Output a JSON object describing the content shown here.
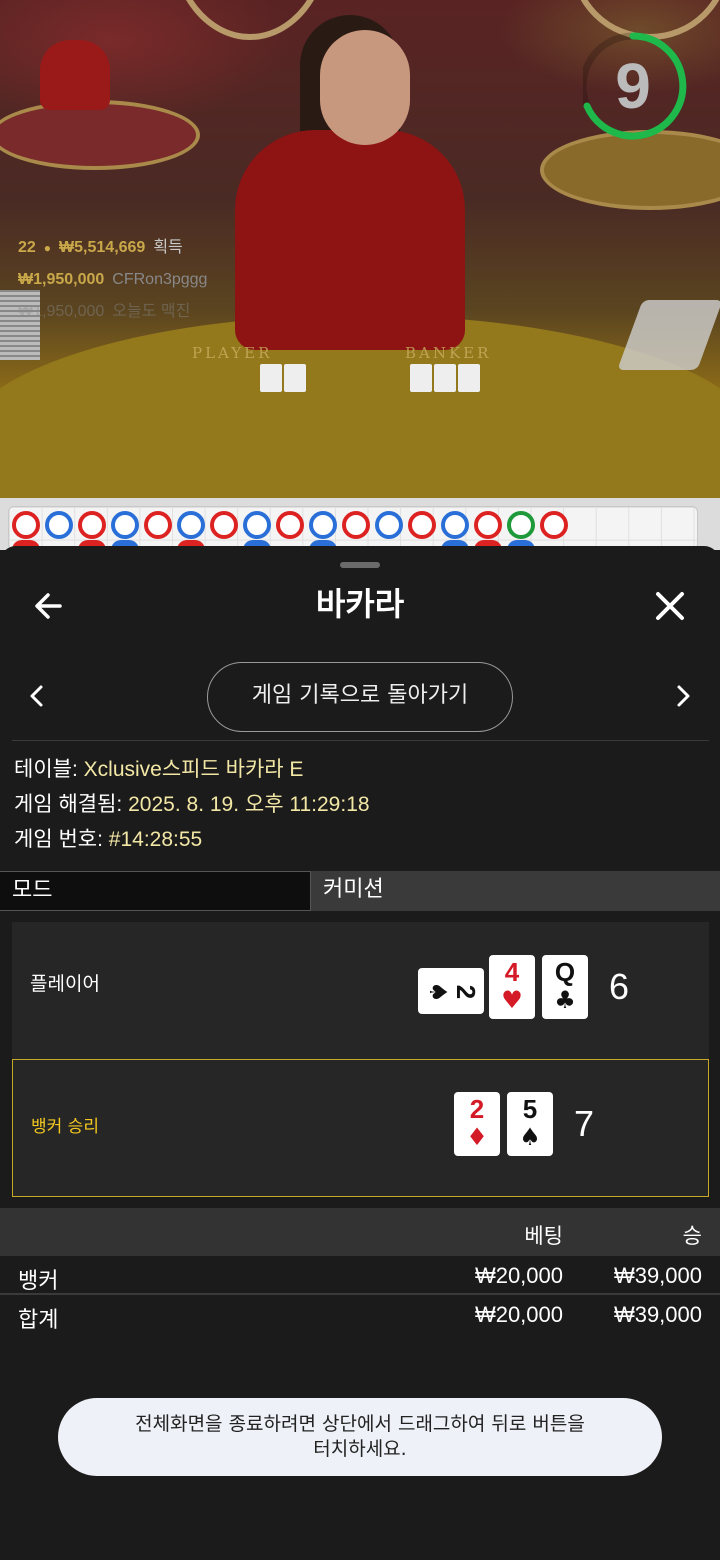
{
  "video": {
    "countdown": "9",
    "stats": {
      "players": "22",
      "winnings": "₩5,514,669",
      "winnings_label": "획득",
      "top_win_amount": "₩1,950,000",
      "top_win_user": "CFRon3pggg",
      "faded_amount": "₩1,950,000",
      "faded_text": "오늘도 맥진"
    },
    "felt_labels": {
      "player": "PLAYER",
      "banker": "BANKER"
    }
  },
  "header": {
    "title": "바카라",
    "back_icon": "arrow-left-icon",
    "close_icon": "close-icon"
  },
  "history": {
    "back_to_history_label": "게임 기록으로 돌아가기",
    "prev_icon": "chevron-left-icon",
    "next_icon": "chevron-right-icon"
  },
  "info": {
    "table_label": "테이블:",
    "table_value": "Xclusive스피드 바카라 E",
    "resolved_label": "게임 해결됨:",
    "resolved_value": "2025. 8. 19. 오후 11:29:18",
    "game_no_label": "게임 번호:",
    "game_no_value": "#14:28:55"
  },
  "tabs": {
    "mode": "모드",
    "commission": "커미션"
  },
  "result": {
    "player": {
      "label": "플레이어",
      "score": "6",
      "cards": [
        {
          "rank": "2",
          "suit": "♠",
          "color": "black",
          "sideways": true
        },
        {
          "rank": "4",
          "suit": "♥",
          "color": "red"
        },
        {
          "rank": "Q",
          "suit": "♣",
          "color": "black"
        }
      ]
    },
    "banker": {
      "label": "뱅커 승리",
      "score": "7",
      "cards": [
        {
          "rank": "2",
          "suit": "♦",
          "color": "red"
        },
        {
          "rank": "5",
          "suit": "♠",
          "color": "black"
        }
      ]
    }
  },
  "bets": {
    "col_bet": "베팅",
    "col_win": "승",
    "rows": [
      {
        "label": "뱅커",
        "bet": "₩20,000",
        "win": "₩39,000"
      },
      {
        "label": "합계",
        "bet": "₩20,000",
        "win": "₩39,000"
      }
    ]
  },
  "toast": {
    "line1": "전체화면을 종료하려면 상단에서 드래그하여 뒤로 버튼을",
    "line2": "터치하세요."
  },
  "colors": {
    "banker_highlight": "#c9a828",
    "info_value": "#f3e7a6",
    "timer_ring": "#1fb84a"
  }
}
